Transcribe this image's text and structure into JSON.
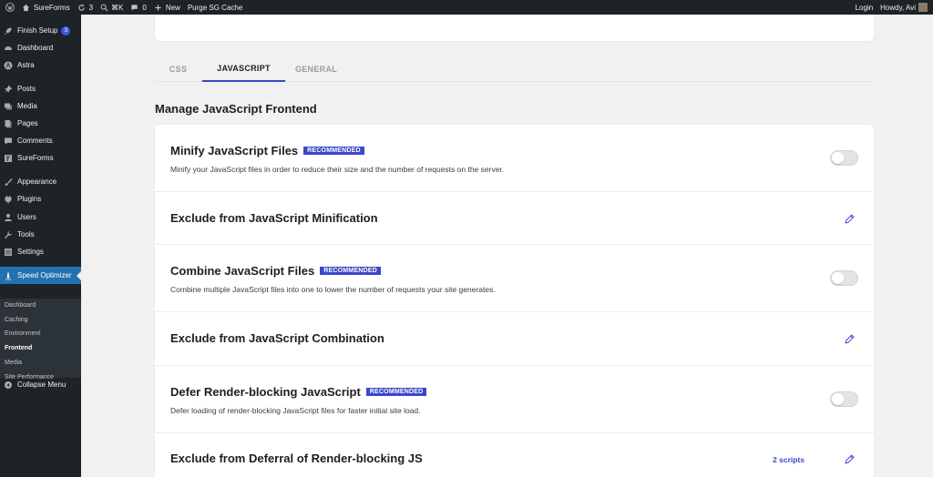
{
  "adminbar": {
    "site_name": "SureForms",
    "updates_count": "3",
    "command_shortcut": "⌘K",
    "comments_count": "0",
    "new_label": "New",
    "purge_label": "Purge SG Cache",
    "login_label": "Login",
    "howdy_label": "Howdy, Avi"
  },
  "sidebar": {
    "items": [
      {
        "label": "Finish Setup",
        "badge": "3",
        "icon": "rocket-icon"
      },
      {
        "label": "Dashboard",
        "icon": "dashboard-icon"
      },
      {
        "label": "Astra",
        "icon": "astra-icon"
      },
      {
        "label": "Posts",
        "icon": "pin-icon"
      },
      {
        "label": "Media",
        "icon": "media-icon"
      },
      {
        "label": "Pages",
        "icon": "pages-icon"
      },
      {
        "label": "Comments",
        "icon": "comment-icon"
      },
      {
        "label": "SureForms",
        "icon": "form-icon"
      },
      {
        "label": "Appearance",
        "icon": "brush-icon"
      },
      {
        "label": "Plugins",
        "icon": "plug-icon"
      },
      {
        "label": "Users",
        "icon": "users-icon"
      },
      {
        "label": "Tools",
        "icon": "wrench-icon"
      },
      {
        "label": "Settings",
        "icon": "settings-icon"
      },
      {
        "label": "Speed Optimizer",
        "icon": "speed-icon"
      }
    ],
    "submenu": [
      "Dashboard",
      "Caching",
      "Environment",
      "Frontend",
      "Media",
      "Site Performance"
    ],
    "collapse_label": "Collapse Menu"
  },
  "tabs": [
    "CSS",
    "JAVASCRIPT",
    "GENERAL"
  ],
  "section_title": "Manage JavaScript Frontend",
  "recommended_label": "RECOMMENDED",
  "rows": [
    {
      "title": "Minify JavaScript Files",
      "desc": "Minify your JavaScript files in order to reduce their size and the number of requests on the server."
    },
    {
      "title": "Exclude from JavaScript Minification"
    },
    {
      "title": "Combine JavaScript Files",
      "desc": "Combine multiple JavaScript files into one to lower the number of requests your site generates."
    },
    {
      "title": "Exclude from JavaScript Combination"
    },
    {
      "title": "Defer Render-blocking JavaScript",
      "desc": "Defer loading of render-blocking JavaScript files for faster initial site load."
    },
    {
      "title": "Exclude from Deferral of Render-blocking JS",
      "link": "2 scripts"
    }
  ],
  "colors": {
    "accent": "#3b47c9",
    "admin_bg": "#1d2327",
    "active_menu": "#2271b1"
  }
}
